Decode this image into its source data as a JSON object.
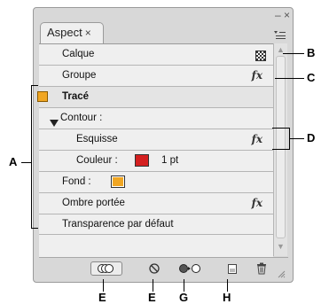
{
  "panel": {
    "tab_label": "Aspect",
    "tab_close": "×",
    "minimize": "–",
    "close": "×"
  },
  "rows": {
    "calque": "Calque",
    "groupe": "Groupe",
    "trace": "Tracé",
    "contour": "Contour :",
    "esquisse": "Esquisse",
    "couleur": "Couleur :",
    "couleur_value": "1 pt",
    "fond": "Fond :",
    "ombre": "Ombre portée",
    "transparence": "Transparence par défaut"
  },
  "fx_label": "fx",
  "colors": {
    "stroke_swatch": "#d42020",
    "fill_swatch": "#f0a623",
    "row_selected_marker": "#f0a623"
  },
  "callouts": {
    "A": "A",
    "B": "B",
    "C": "C",
    "D": "D",
    "E1": "E",
    "E2": "E",
    "G": "G",
    "H": "H"
  },
  "icons": {
    "layer_thumb": "checker-icon",
    "fx": "fx-icon",
    "triangle": "triangle-down-icon"
  }
}
